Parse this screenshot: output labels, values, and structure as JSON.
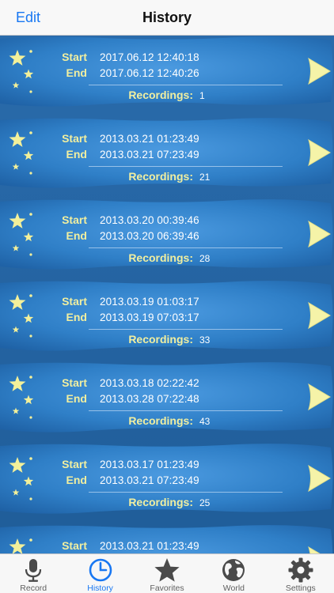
{
  "nav": {
    "edit_label": "Edit",
    "title": "History"
  },
  "labels": {
    "start": "Start",
    "end": "End",
    "recordings": "Recordings:"
  },
  "sessions": [
    {
      "start": "2017.06.12 12:40:18",
      "end": "2017.06.12 12:40:26",
      "count": "1"
    },
    {
      "start": "2013.03.21 01:23:49",
      "end": "2013.03.21 07:23:49",
      "count": "21"
    },
    {
      "start": "2013.03.20 00:39:46",
      "end": "2013.03.20 06:39:46",
      "count": "28"
    },
    {
      "start": "2013.03.19 01:03:17",
      "end": "2013.03.19 07:03:17",
      "count": "33"
    },
    {
      "start": "2013.03.18 02:22:42",
      "end": "2013.03.28 07:22:48",
      "count": "43"
    },
    {
      "start": "2013.03.17 01:23:49",
      "end": "2013.03.21 07:23:49",
      "count": "25"
    },
    {
      "start": "2013.03.21 01:23:49",
      "end": "",
      "count": ""
    }
  ],
  "tabs": [
    {
      "label": "Record",
      "icon": "microphone-icon"
    },
    {
      "label": "History",
      "icon": "clock-icon"
    },
    {
      "label": "Favorites",
      "icon": "star-icon"
    },
    {
      "label": "World",
      "icon": "globe-icon"
    },
    {
      "label": "Settings",
      "icon": "gear-icon"
    }
  ],
  "colors": {
    "accent": "#1877f2",
    "label_yellow": "#f1efa0",
    "card_blue": "#2f7fc7",
    "background_blue": "#1f5d99"
  },
  "active_tab": "History"
}
